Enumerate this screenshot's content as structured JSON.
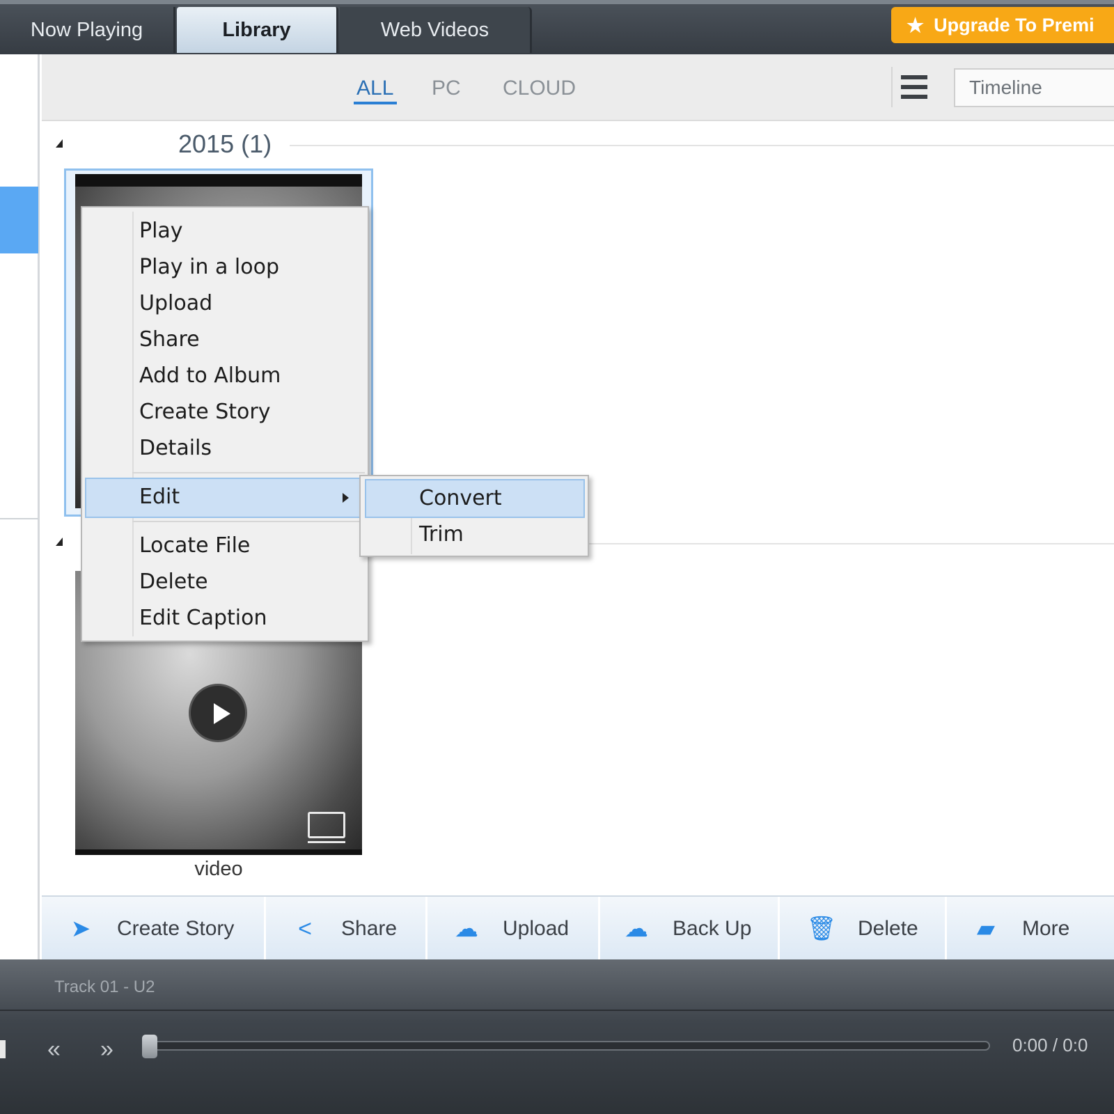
{
  "tabs": {
    "now_playing": "Now Playing",
    "library": "Library",
    "web_videos": "Web Videos"
  },
  "upgrade": {
    "label": "Upgrade To Premi",
    "icon": "star-icon",
    "color": "#f8a816"
  },
  "filters": {
    "all": "ALL",
    "pc": "PC",
    "cloud": "CLOUD",
    "active": "ALL"
  },
  "view_select": {
    "value": "Timeline"
  },
  "groups": [
    {
      "label": "2015 (1)"
    }
  ],
  "thumbnail": {
    "caption": "video"
  },
  "context_menu": {
    "items": [
      "Play",
      "Play in a loop",
      "Upload",
      "Share",
      "Add to Album",
      "Create Story",
      "Details"
    ],
    "edit": "Edit",
    "items_after": [
      "Locate File",
      "Delete",
      "Edit Caption"
    ],
    "submenu": [
      "Convert",
      "Trim"
    ]
  },
  "actions": {
    "create_story": "Create Story",
    "share": "Share",
    "upload": "Upload",
    "back_up": "Back Up",
    "delete": "Delete",
    "more": "More"
  },
  "player": {
    "track": "Track 01 - U2",
    "time": "0:00 / 0:0",
    "progress": 0
  },
  "colors": {
    "accent": "#2a7fd4",
    "selection": "#5aa8f3",
    "menu_highlight": "#cce0f5"
  }
}
